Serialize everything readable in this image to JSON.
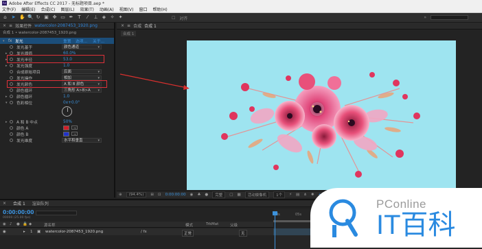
{
  "window": {
    "title": "Adobe After Effects CC 2017 - 无标题项目.aep *",
    "app_icon": "Ae"
  },
  "menu": [
    "文件(F)",
    "编辑(E)",
    "合成(C)",
    "图层(L)",
    "效果(T)",
    "动画(A)",
    "视图(V)",
    "窗口",
    "帮助(H)"
  ],
  "toolbar": {
    "snap_label": "对齐",
    "workspace_icons": [
      "home-icon",
      "selection-icon",
      "hand-icon",
      "zoom-icon",
      "rotate-icon",
      "camera-icon",
      "pan-icon",
      "rect-icon",
      "pen-icon",
      "text-icon",
      "brush-icon",
      "stamp-icon",
      "eraser-icon",
      "roto-icon",
      "pin-icon"
    ]
  },
  "effect_panel": {
    "tab_label": "效果控件",
    "tab_file": "watercolor-2087453_1920.png",
    "subtitle": "合成 1 • watercolor-2087453_1920.png",
    "effect_name": "发光",
    "reset_label": "重置",
    "options_label": "选项...",
    "about_label": "关于...",
    "rows": [
      {
        "label": "发光基于",
        "value": "颜色通道",
        "type": "dropdown"
      },
      {
        "label": "发光阈值",
        "value": "60.0%",
        "type": "value"
      },
      {
        "label": "发光半径",
        "value": "53.0",
        "type": "value",
        "highlight": true
      },
      {
        "label": "发光强度",
        "value": "1.0",
        "type": "value"
      },
      {
        "label": "合成原始项目",
        "value": "后面",
        "type": "dropdown"
      },
      {
        "label": "发光操作",
        "value": "相加",
        "type": "dropdown"
      },
      {
        "label": "发光颜色",
        "value": "A 和 B 颜色",
        "type": "dropdown",
        "highlight": true
      },
      {
        "label": "颜色循环",
        "value": "三角形 A>B>A",
        "type": "dropdown"
      },
      {
        "label": "颜色循环",
        "value": "1.0",
        "type": "value"
      },
      {
        "label": "色彩相位",
        "value": "0x+0.0°",
        "type": "value"
      },
      {
        "label": "A 和 B 中点",
        "value": "50%",
        "type": "value"
      },
      {
        "label": "颜色 A",
        "value": "#d0202a",
        "type": "color"
      },
      {
        "label": "颜色 B",
        "value": "#2233c8",
        "type": "color"
      },
      {
        "label": "发光维度",
        "value": "水平和垂直",
        "type": "dropdown"
      }
    ]
  },
  "comp_panel": {
    "tab_label": "合成",
    "comp_name": "合成 1",
    "breadcrumb": "合成 1",
    "bottom": {
      "zoom": "(94.4%)",
      "timecode": "0:00:00:00",
      "resolution": "完整",
      "camera": "活动摄像机",
      "views": "1个",
      "offset": "+0.0"
    }
  },
  "timeline": {
    "tab_label": "合成 1",
    "tab_render": "渲染队列",
    "timecode": "0:00:00:00",
    "fps": "00000 (25.00 fps)",
    "columns": {
      "source": "源名称",
      "mode": "模式",
      "trkmat": "TrkMat",
      "parent": "父级"
    },
    "layer": {
      "index": "1",
      "name": "watercolor-2087453_1920.png",
      "mode": "正常",
      "parent": "无"
    },
    "ruler_marks": [
      "0s",
      "05s"
    ]
  },
  "watermark": {
    "top": "PConline",
    "main": "IT百科"
  }
}
